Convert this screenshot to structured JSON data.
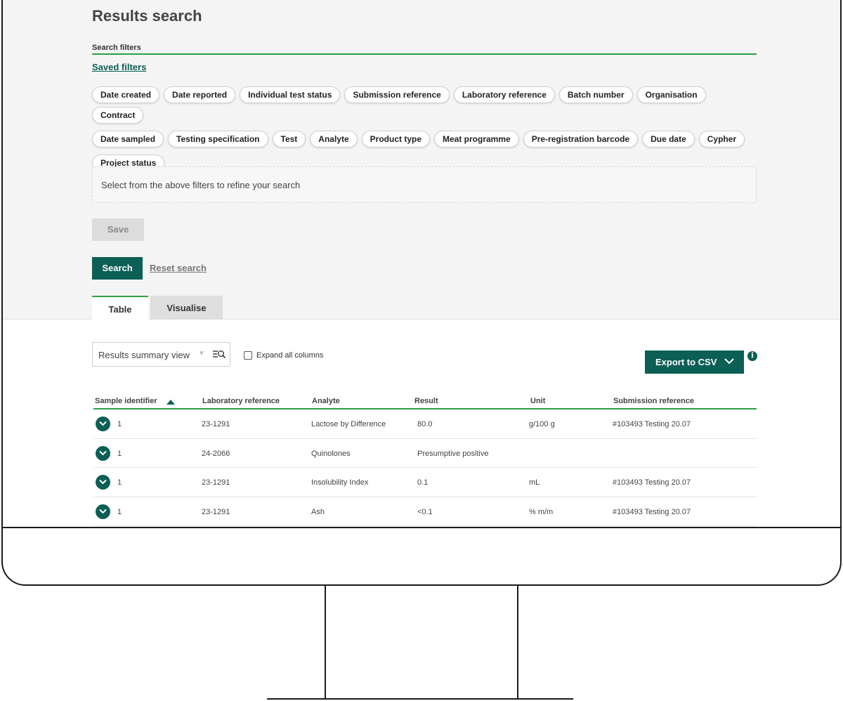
{
  "page": {
    "title": "Results search",
    "filters_label": "Search filters",
    "saved_filters_link": "Saved filters",
    "filter_chips": [
      "Date created",
      "Date reported",
      "Individual test status",
      "Submission reference",
      "Laboratory reference",
      "Batch number",
      "Organisation",
      "Contract",
      "Date sampled",
      "Testing specification",
      "Test",
      "Analyte",
      "Product type",
      "Meat programme",
      "Pre-registration barcode",
      "Due date",
      "Cypher",
      "Project status"
    ],
    "hint": "Select from the above filters to refine your search",
    "save_label": "Save",
    "search_label": "Search",
    "reset_label": "Reset search"
  },
  "tabs": [
    {
      "label": "Table",
      "active": true
    },
    {
      "label": "Visualise",
      "active": false
    }
  ],
  "toolbar": {
    "view_select_value": "Results summary view",
    "expand_label": "Expand all columns",
    "expand_checked": false,
    "export_label": "Export to CSV",
    "info_glyph": "i"
  },
  "table": {
    "headers": [
      "Sample identifier",
      "Laboratory reference",
      "Analyte",
      "Result",
      "Unit",
      "Submission reference"
    ],
    "sort_column": "Sample identifier",
    "sort_direction": "ascending",
    "rows": [
      {
        "sample": "1",
        "lab_ref": "23-1291",
        "analyte": "Lactose by Difference",
        "result": "80.0",
        "unit": "g/100 g",
        "submission": "#103493 Testing 20.07"
      },
      {
        "sample": "1",
        "lab_ref": "24-2066",
        "analyte": "Quinolones",
        "result": "Presumptive positive",
        "unit": "",
        "submission": ""
      },
      {
        "sample": "1",
        "lab_ref": "23-1291",
        "analyte": "Insolubility Index",
        "result": "0.1",
        "unit": "mL",
        "submission": "#103493 Testing 20.07"
      },
      {
        "sample": "1",
        "lab_ref": "23-1291",
        "analyte": "Ash",
        "result": "<0.1",
        "unit": "% m/m",
        "submission": "#103493 Testing 20.07"
      }
    ]
  },
  "colors": {
    "brand_teal": "#0b5f55",
    "accent_green": "#2e9e45",
    "panel_grey": "#f4f4f4"
  },
  "icons": {
    "view_filter": "filter-search-icon",
    "export_chevron": "chevron-down-icon",
    "info": "info-icon",
    "row_expand": "chevron-down-circle-icon",
    "sort": "sort-ascending-icon"
  }
}
